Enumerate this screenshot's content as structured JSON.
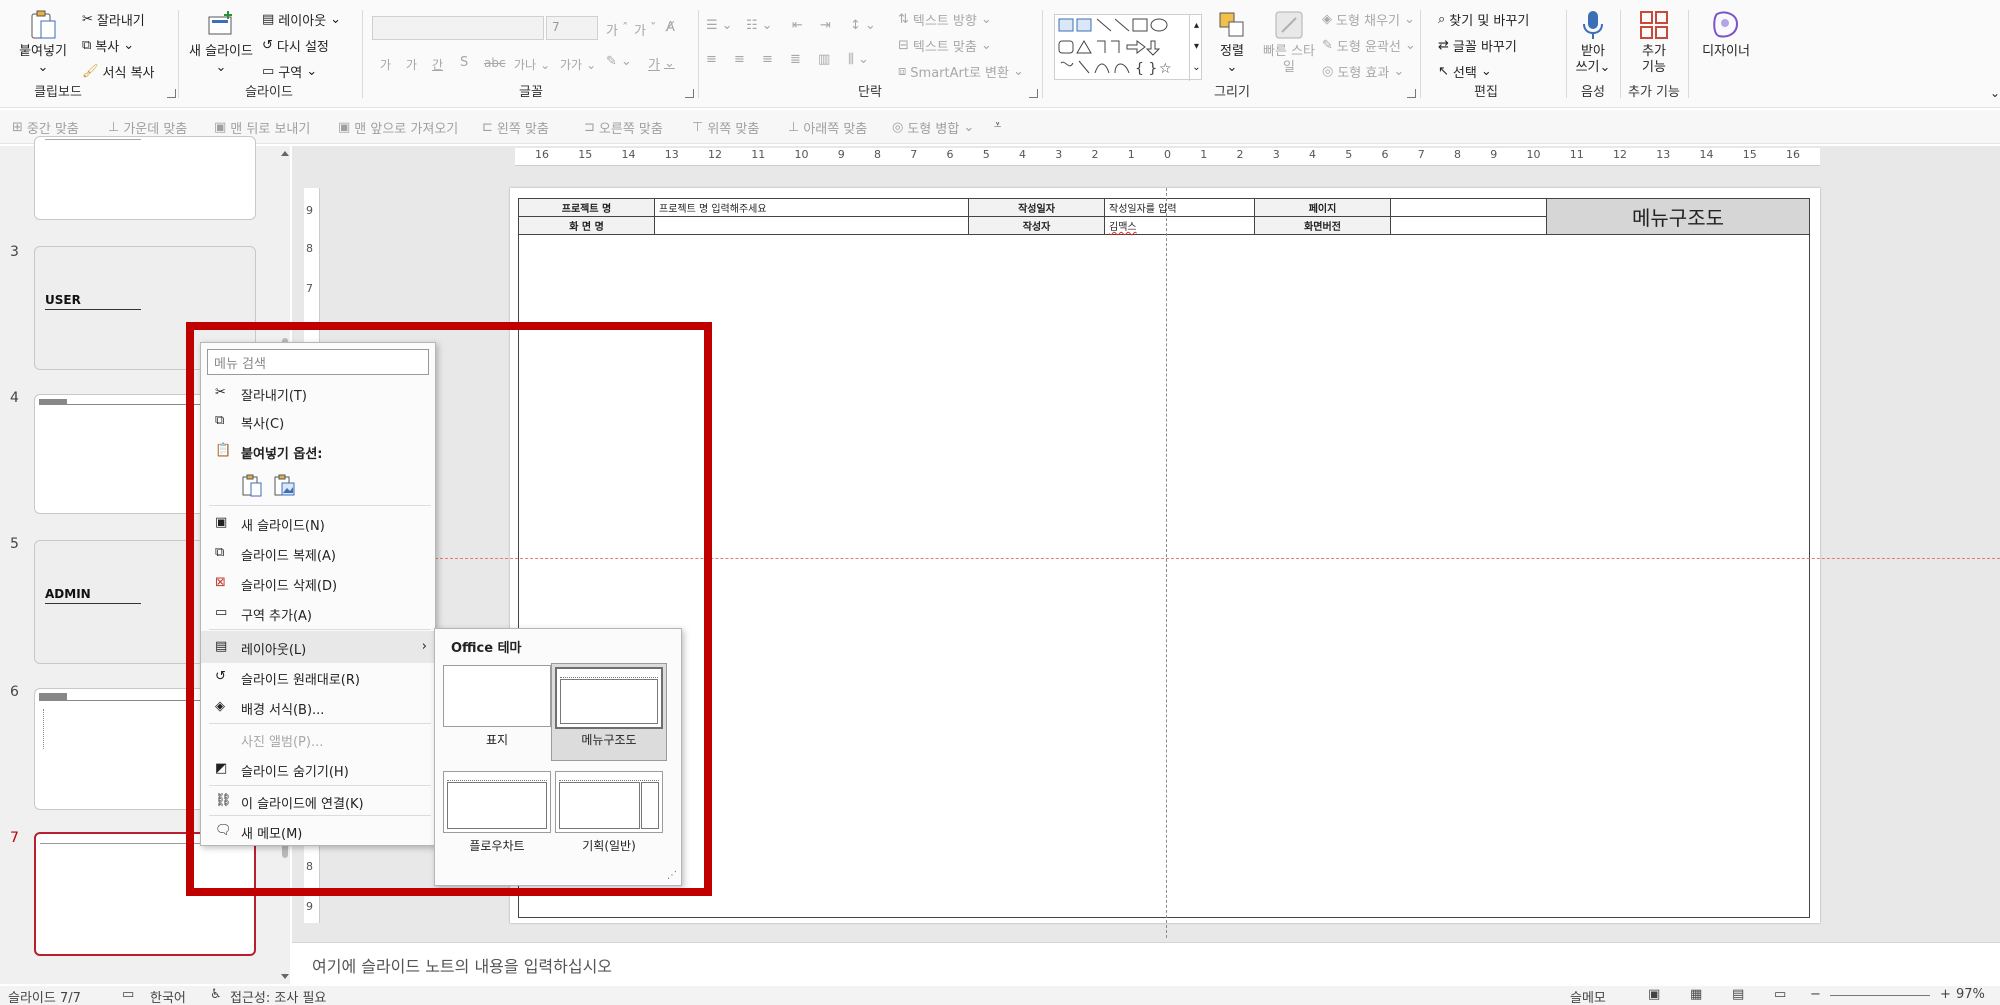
{
  "ribbon": {
    "clipboard": {
      "paste": "붙여넣기",
      "cut": "잘라내기",
      "copy": "복사",
      "format_painter": "서식 복사",
      "label": "클립보드"
    },
    "slides": {
      "new_slide": "새 슬라이드",
      "layout": "레이아웃",
      "reset": "다시 설정",
      "section": "구역",
      "label": "슬라이드"
    },
    "font": {
      "size_value": "7",
      "increase": "가",
      "decrease": "가",
      "bold": "가",
      "italic": "가",
      "underline": "간",
      "strike": "S",
      "spacing": "가나",
      "case": "가가",
      "label": "글꼴"
    },
    "paragraph": {
      "text_direction": "텍스트 방향",
      "align_text": "텍스트 맞춤",
      "smartart": "SmartArt로 변환",
      "label": "단락"
    },
    "drawing": {
      "arrange": "정렬",
      "quick_styles": "빠른 스타일",
      "shape_fill": "도형 채우기",
      "shape_outline": "도형 윤곽선",
      "shape_effects": "도형 효과",
      "label": "그리기"
    },
    "editing": {
      "find": "찾기 및 바꾸기",
      "replace_fonts": "글꼴 바꾸기",
      "select": "선택",
      "label": "편집"
    },
    "voice": {
      "dictate_line1": "받아",
      "dictate_line2": "쓰기",
      "label": "음성"
    },
    "addins": {
      "line1": "추가",
      "line2": "기능",
      "label": "추가 기능"
    },
    "designer": {
      "label": "디자이너"
    }
  },
  "qat": {
    "items": [
      "중간 맞춤",
      "가운데 맞춤",
      "맨 뒤로 보내기",
      "맨 앞으로 가져오기",
      "왼쪽 맞춤",
      "오른쪽 맞춤",
      "위쪽 맞춤",
      "아래쪽 맞춤",
      "도형 병합"
    ]
  },
  "ruler": {
    "h_ticks": [
      "16",
      "15",
      "14",
      "13",
      "12",
      "11",
      "10",
      "9",
      "8",
      "7",
      "6",
      "5",
      "4",
      "3",
      "2",
      "1",
      "0",
      "1",
      "2",
      "3",
      "4",
      "5",
      "6",
      "7",
      "8",
      "9",
      "10",
      "11",
      "12",
      "13",
      "14",
      "15",
      "16"
    ],
    "v_ticks": [
      "9",
      "8",
      "7",
      "8",
      "9"
    ]
  },
  "thumbnails": [
    {
      "num": "",
      "label": ""
    },
    {
      "num": "3",
      "label": "USER"
    },
    {
      "num": "4",
      "label": ""
    },
    {
      "num": "5",
      "label": "ADMIN"
    },
    {
      "num": "6",
      "label": ""
    },
    {
      "num": "7",
      "label": ""
    }
  ],
  "slide": {
    "project_name_label": "프로젝트 명",
    "project_name_value": "프로젝트 명 입력해주세요",
    "screen_name_label": "화 면 명",
    "author_date_label": "작성일자",
    "author_date_value": "작성일자를 입력",
    "author_label": "작성자",
    "author_value": "김맥스",
    "page_label": "페이지",
    "screen_version_label": "화면버전",
    "title": "메뉴구조도"
  },
  "notes": {
    "placeholder": "여기에 슬라이드 노트의 내용을 입력하십시오"
  },
  "status": {
    "slide_count": "슬라이드 7/7",
    "language": "한국어",
    "accessibility": "접근성: 조사 필요",
    "notes": "슬메모",
    "zoom": "97%"
  },
  "context_menu": {
    "search_placeholder": "메뉴 검색",
    "cut": "잘라내기(T)",
    "copy": "복사(C)",
    "paste_options": "붙여넣기 옵션:",
    "new_slide": "새 슬라이드(N)",
    "duplicate_slide": "슬라이드 복제(A)",
    "delete_slide": "슬라이드 삭제(D)",
    "add_section": "구역 추가(A)",
    "layout": "레이아웃(L)",
    "reset_slide": "슬라이드 원래대로(R)",
    "format_background": "배경 서식(B)...",
    "photo_album": "사진 앨범(P)...",
    "hide_slide": "슬라이드 숨기기(H)",
    "link_slide": "이 슬라이드에 연결(K)",
    "new_comment": "새 메모(M)"
  },
  "layout_submenu": {
    "title": "Office 테마",
    "layouts": [
      "표지",
      "메뉴구조도",
      "플로우차트",
      "기획(일반)"
    ],
    "selected": "메뉴구조도"
  },
  "colors": {
    "highlight": "#c00000",
    "accent": "#2b579a"
  }
}
